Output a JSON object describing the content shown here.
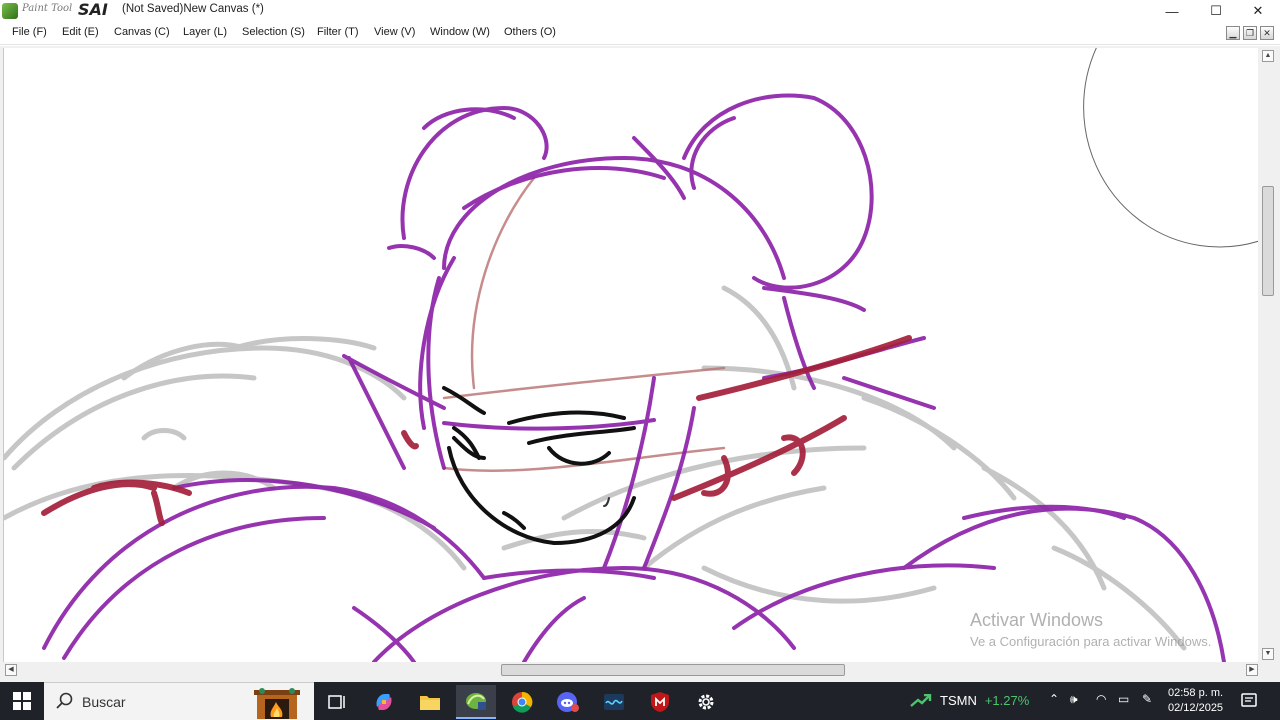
{
  "window": {
    "app_name_small": "Paint Tool",
    "app_name_big": "SAI",
    "title": "(Not Saved)New Canvas (*)",
    "controls": {
      "minimize": "—",
      "maximize": "☐",
      "close": "✕"
    }
  },
  "menu": {
    "items": [
      "File (F)",
      "Edit (E)",
      "Canvas (C)",
      "Layer (L)",
      "Selection (S)",
      "Filter (T)",
      "View (V)",
      "Window (W)",
      "Others (O)"
    ]
  },
  "watermark": {
    "line1": "Activar Windows",
    "line2": "Ve a Configuración para activar Windows."
  },
  "taskbar": {
    "search_placeholder": "Buscar",
    "apps": [
      "task-view-icon",
      "copilot-icon",
      "file-explorer-icon",
      "paint-tool-sai-icon",
      "chrome-icon",
      "discord-icon",
      "wave-app-icon",
      "mcafee-icon",
      "settings-icon"
    ],
    "stock_symbol": "TSMN",
    "stock_change": "+1.27%",
    "clock_time": "02:58 p. m.",
    "clock_date": "02/12/2025"
  },
  "colors": {
    "sketch_purple": "#8b1fa8",
    "sketch_red": "#a3203a",
    "sketch_gray": "#bdbdbd",
    "taskbar_bg": "#1f2229",
    "stock_up": "#4cc46c"
  }
}
